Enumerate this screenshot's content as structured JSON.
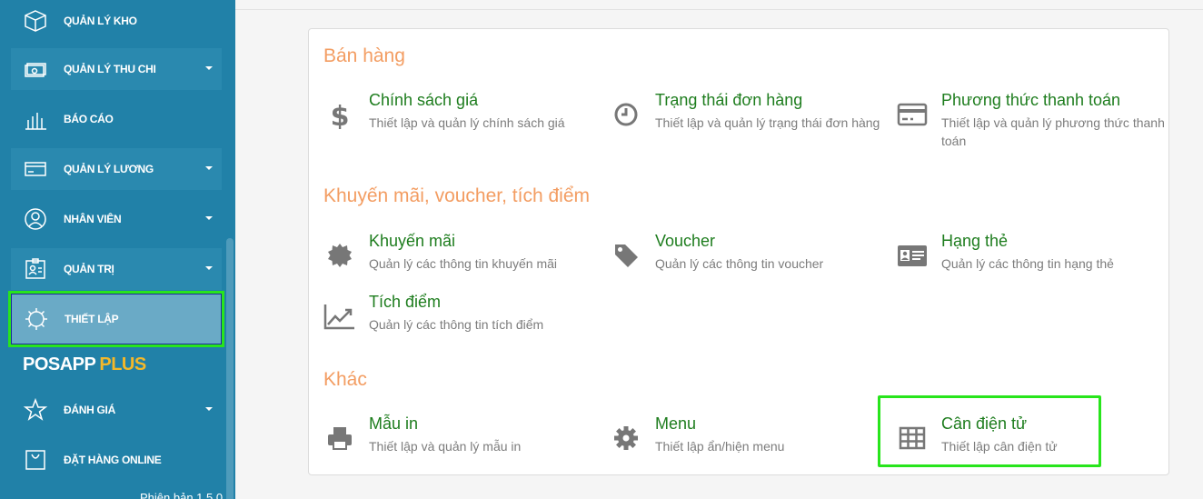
{
  "sidebar": {
    "items": [
      {
        "label": "QUẢN LÝ KHO",
        "icon": "box-icon",
        "caret": false
      },
      {
        "label": "QUẢN LÝ THU CHI",
        "icon": "money-icon",
        "caret": true
      },
      {
        "label": "BÁO CÁO",
        "icon": "bar-chart-icon",
        "caret": false
      },
      {
        "label": "QUẢN LÝ LƯƠNG",
        "icon": "card-icon",
        "caret": true
      },
      {
        "label": "NHÂN VIÊN",
        "icon": "user-icon",
        "caret": true
      },
      {
        "label": "QUẢN TRỊ",
        "icon": "id-badge-icon",
        "caret": true
      },
      {
        "label": "THIẾT LẬP",
        "icon": "gear-icon",
        "caret": false
      },
      {
        "label": "ĐÁNH GIÁ",
        "icon": "star-icon",
        "caret": true
      },
      {
        "label": "ĐẶT HÀNG ONLINE",
        "icon": "bag-icon",
        "caret": false
      }
    ],
    "brand": {
      "part1": "POSAPP",
      "part2": "PLUS"
    },
    "version": "Phiên bản 1.5.0"
  },
  "sections": [
    {
      "title": "Bán hàng",
      "cards": [
        {
          "title": "Chính sách giá",
          "desc": "Thiết lập và quản lý chính sách giá",
          "icon": "dollar-icon"
        },
        {
          "title": "Trạng thái đơn hàng",
          "desc": "Thiết lập và quản lý trạng thái đơn hàng",
          "icon": "clock-icon"
        },
        {
          "title": "Phương thức thanh toán",
          "desc": "Thiết lập và quản lý phương thức thanh toán",
          "icon": "credit-card-icon"
        }
      ]
    },
    {
      "title": "Khuyến mãi, voucher, tích điểm",
      "cards": [
        {
          "title": "Khuyến mãi",
          "desc": "Quản lý các thông tin khuyến mãi",
          "icon": "badge-icon"
        },
        {
          "title": "Voucher",
          "desc": "Quản lý các thông tin voucher",
          "icon": "tag-icon"
        },
        {
          "title": "Hạng thẻ",
          "desc": "Quản lý các thông tin hạng thẻ",
          "icon": "member-card-icon"
        },
        {
          "title": "Tích điểm",
          "desc": "Quản lý các thông tin tích điểm",
          "icon": "trend-icon"
        }
      ]
    },
    {
      "title": "Khác",
      "cards": [
        {
          "title": "Mẫu in",
          "desc": "Thiết lập và quản lý mẫu in",
          "icon": "printer-icon"
        },
        {
          "title": "Menu",
          "desc": "Thiết lập ẩn/hiện menu",
          "icon": "cog-icon"
        },
        {
          "title": "Cân điện tử",
          "desc": "Thiết lập cân điện tử",
          "icon": "table-icon"
        }
      ]
    }
  ],
  "colors": {
    "sidebar": "#2181a8",
    "accent_title": "#f39d62",
    "card_title": "#1e7d1e",
    "highlight": "#28e51c",
    "brand_plus": "#f4b829"
  }
}
